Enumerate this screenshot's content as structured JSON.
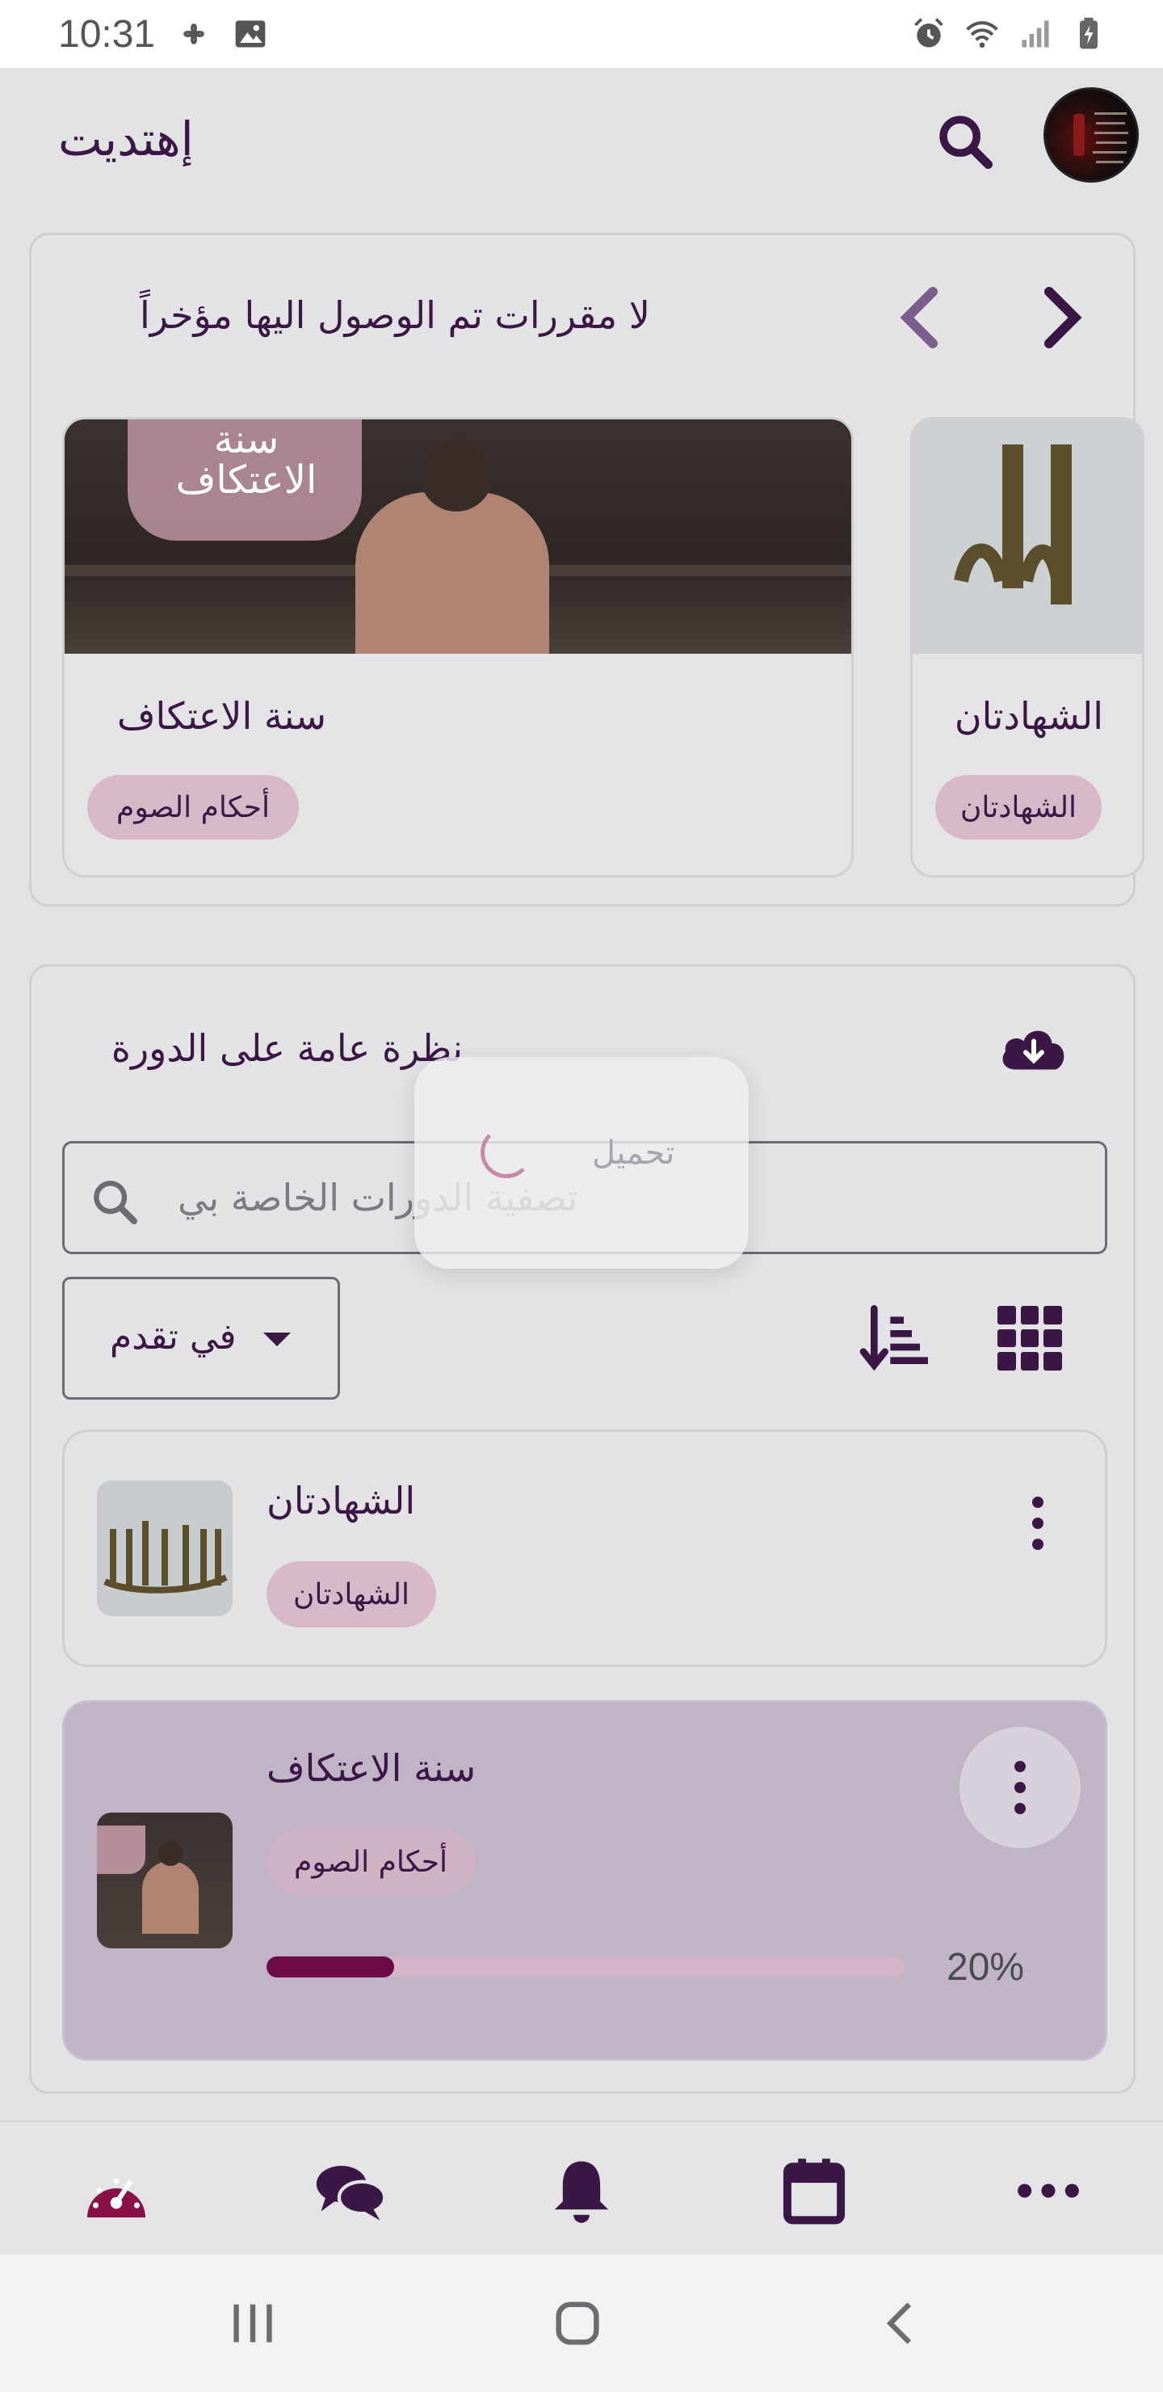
{
  "status": {
    "time": "10:31"
  },
  "appbar": {
    "title": "إهتديت"
  },
  "recent": {
    "title": "لا مقررات تم الوصول اليها مؤخراً",
    "cards": [
      {
        "title": "سنة الاعتكاف",
        "category": "أحكام الصوم",
        "image_text": "سنة\nالاعتكاف"
      },
      {
        "title": "الشهادتان",
        "category": "الشهادتان"
      }
    ]
  },
  "overview": {
    "title": "نظرة عامة على الدورة",
    "search_placeholder": "تصفية الدورات الخاصة بي",
    "filter_value": "في تقدم",
    "courses": [
      {
        "title": "الشهادتان",
        "category": "الشهادتان"
      },
      {
        "title": "سنة الاعتكاف",
        "category": "أحكام الصوم",
        "progress_text": "20%",
        "progress": 0.2
      }
    ]
  },
  "loading": {
    "text": "تحميل"
  },
  "icons": {
    "accent": "#3b1746",
    "brand": "#6d0b47"
  }
}
